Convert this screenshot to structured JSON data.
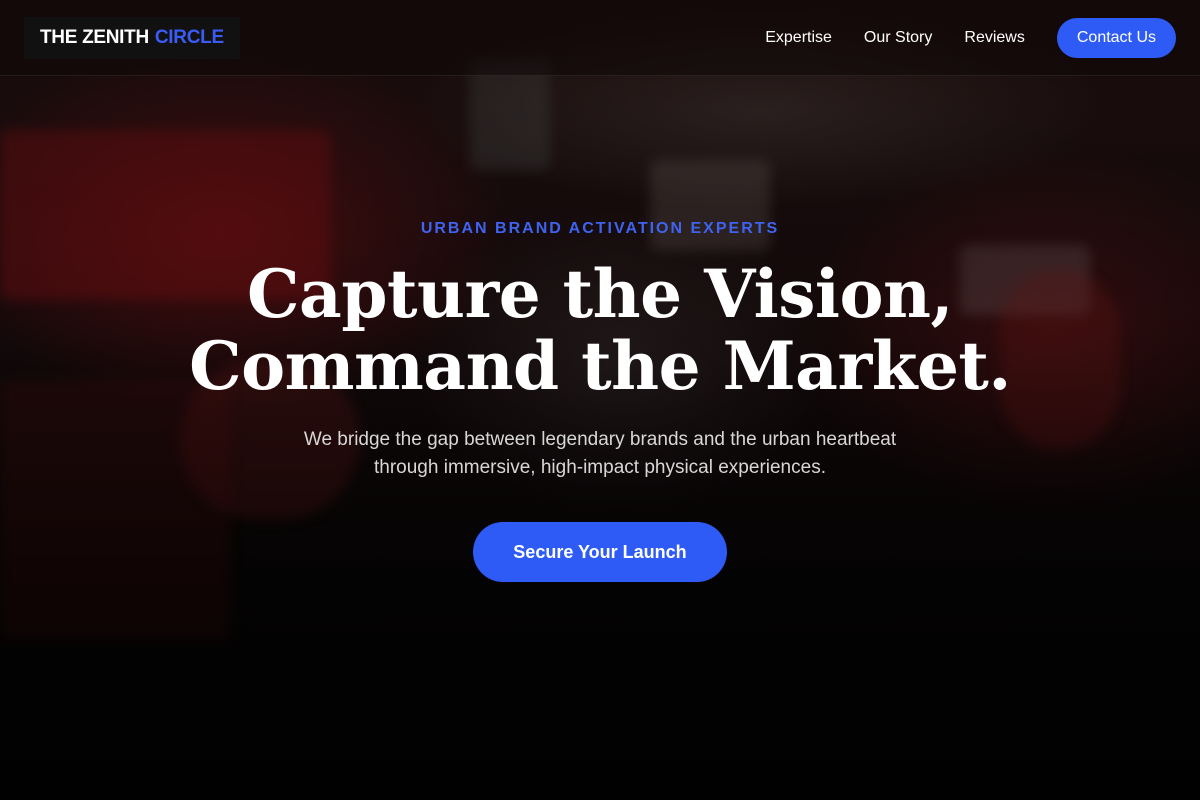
{
  "brand": {
    "name_part1": "THE ZENITH",
    "name_part2": "CIRCLE",
    "accent_color": "#3a5cf5"
  },
  "nav": {
    "links": [
      {
        "label": "Expertise"
      },
      {
        "label": "Our Story"
      },
      {
        "label": "Reviews"
      }
    ],
    "cta_label": "Contact Us"
  },
  "hero": {
    "eyebrow": "URBAN BRAND ACTIVATION EXPERTS",
    "headline_line1": "Capture the Vision,",
    "headline_line2": "Command the Market.",
    "subtext_line1": "We bridge the gap between legendary brands and the urban heartbeat",
    "subtext_line2": "through immersive, high-impact physical experiences.",
    "cta_label": "Secure Your Launch"
  },
  "colors": {
    "primary": "#2e5bf5",
    "text": "#ffffff"
  }
}
